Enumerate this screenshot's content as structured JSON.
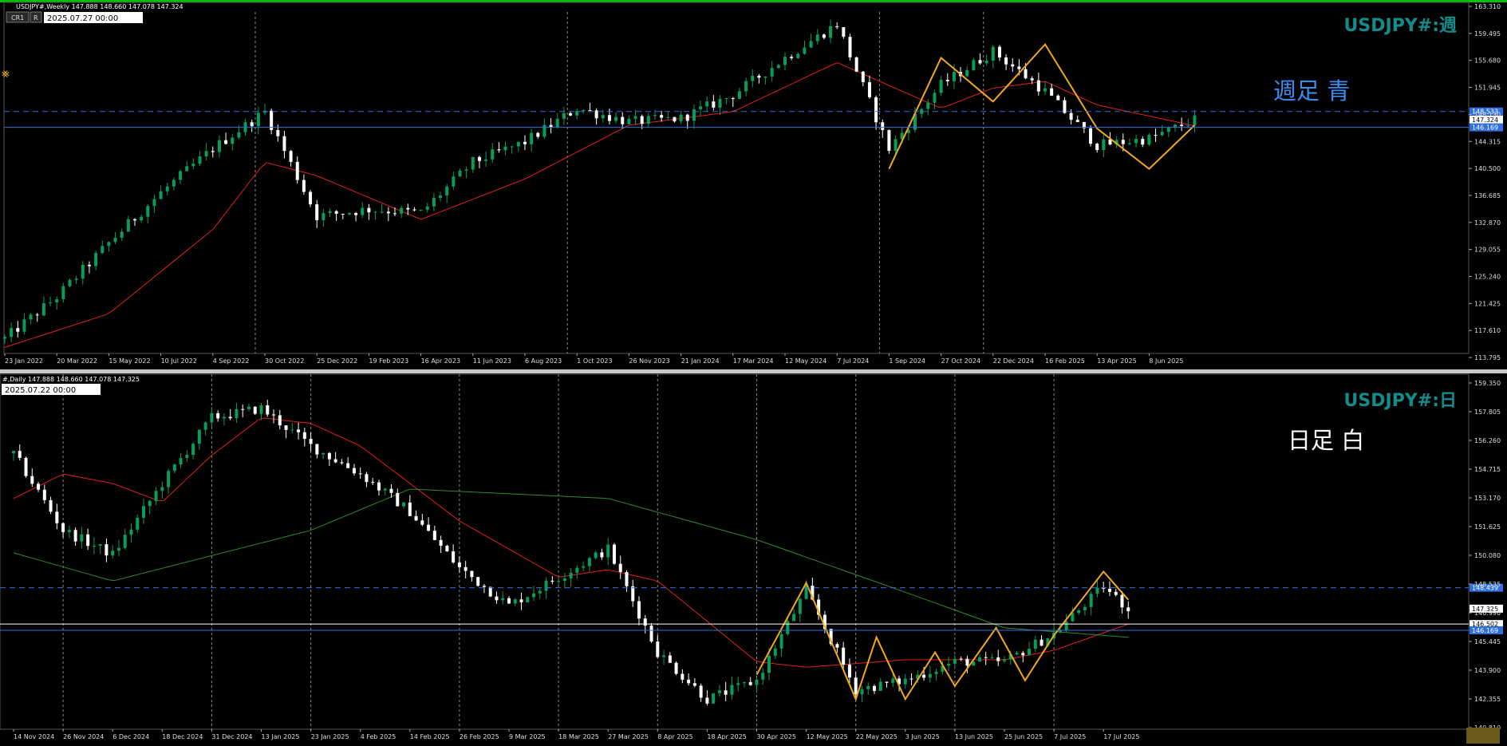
{
  "colors": {
    "background": "#000000",
    "bull": "#0A9D58",
    "bear": "#FFFFFF",
    "ma_fast": "#E0201E",
    "ma_slow": "#2E8B2E",
    "zigzag": "#F2A81D",
    "hline_blue": "#2F6FE0",
    "hline_white": "#FFFFFF",
    "grid": "#8A8A8A",
    "symbol": "#138C8C",
    "active_border": "#00C000"
  },
  "weekly": {
    "info_text": "USDJPY#,Weekly  147.888 148.660 147.078 147.324",
    "buttons": [
      "CR1",
      "R"
    ],
    "cursor_time": "2025.07.27 00:00",
    "symbol_label": "USDJPY#:週",
    "note_label": "週足 青",
    "y_ticks": [
      "163.310",
      "159.495",
      "155.680",
      "151.945",
      "148.130",
      "144.315",
      "140.500",
      "136.685",
      "132.870",
      "129.055",
      "125.240",
      "121.425",
      "117.610",
      "113.795"
    ],
    "x_labels": [
      "23 Jan 2022",
      "20 Mar 2022",
      "15 May 2022",
      "10 Jul 2022",
      "4 Sep 2022",
      "30 Oct 2022",
      "25 Dec 2022",
      "19 Feb 2023",
      "16 Apr 2023",
      "11 Jun 2023",
      "6 Aug 2023",
      "1 Oct 2023",
      "26 Nov 2023",
      "21 Jan 2024",
      "17 Mar 2024",
      "12 May 2024",
      "7 Jul 2024",
      "1 Sep 2024",
      "27 Oct 2024",
      "22 Dec 2024",
      "16 Feb 2025",
      "13 Apr 2025",
      "8 Jun 2025"
    ],
    "price_tags": [
      {
        "text": "148.533",
        "value": 148.533,
        "style": "blue"
      },
      {
        "text": "147.324",
        "value": 147.324,
        "style": "white"
      },
      {
        "text": "146.169",
        "value": 146.169,
        "style": "blue"
      }
    ]
  },
  "daily": {
    "info_text": "#,Daily  147.888 148.660 147.078 147.325",
    "cursor_time": "2025.07.22 00:00",
    "symbol_label": "USDJPY#:日",
    "note_label": "日足 白",
    "y_ticks": [
      "159.350",
      "157.805",
      "156.260",
      "154.715",
      "153.170",
      "151.625",
      "150.080",
      "148.535",
      "146.990",
      "145.445",
      "143.900",
      "142.355",
      "140.810"
    ],
    "x_labels": [
      "14 Nov 2024",
      "26 Nov 2024",
      "6 Dec 2024",
      "18 Dec 2024",
      "31 Dec 2024",
      "13 Jan 2025",
      "23 Jan 2025",
      "4 Feb 2025",
      "14 Feb 2025",
      "26 Feb 2025",
      "9 Mar 2025",
      "18 Mar 2025",
      "27 Mar 2025",
      "8 Apr 2025",
      "18 Apr 2025",
      "30 Apr 2025",
      "12 May 2025",
      "22 May 2025",
      "3 Jun 2025",
      "13 Jun 2025",
      "25 Jun 2025",
      "7 Jul 2025",
      "17 Jul 2025"
    ],
    "price_tags": [
      {
        "text": "148.439",
        "value": 148.439,
        "style": "blue"
      },
      {
        "text": "147.325",
        "value": 147.325,
        "style": "white"
      },
      {
        "text": "146.502",
        "value": 146.502,
        "style": "white"
      },
      {
        "text": "146.169",
        "value": 146.169,
        "style": "blue"
      }
    ]
  },
  "chart_data": [
    {
      "type": "candlestick",
      "symbol": "USDJPY#",
      "timeframe": "Weekly",
      "title": "USDJPY#:週",
      "ylim": [
        112.595,
        163.31
      ],
      "last_ohlc": {
        "open": 147.888,
        "high": 148.66,
        "low": 147.078,
        "close": 147.324
      },
      "horizontal_lines": [
        148.533,
        146.169
      ],
      "price_path": [
        [
          "23 Jan 2022",
          114.8
        ],
        [
          "20 Mar 2022",
          121.0
        ],
        [
          "15 May 2022",
          129.0
        ],
        [
          "10 Jul 2022",
          136.5
        ],
        [
          "4 Sep 2022",
          143.0
        ],
        [
          "30 Oct 2022",
          148.5
        ],
        [
          "25 Dec 2022",
          133.0
        ],
        [
          "19 Feb 2023",
          134.0
        ],
        [
          "16 Apr 2023",
          133.5
        ],
        [
          "11 Jun 2023",
          141.0
        ],
        [
          "6 Aug 2023",
          144.0
        ],
        [
          "1 Oct 2023",
          149.0
        ],
        [
          "26 Nov 2023",
          147.0
        ],
        [
          "21 Jan 2024",
          147.5
        ],
        [
          "17 Mar 2024",
          151.0
        ],
        [
          "12 May 2024",
          156.5
        ],
        [
          "7 Jul 2024",
          161.5
        ],
        [
          "1 Sep 2024",
          143.0
        ],
        [
          "27 Oct 2024",
          152.5
        ],
        [
          "22 Dec 2024",
          157.5
        ],
        [
          "16 Feb 2025",
          151.5
        ],
        [
          "13 Apr 2025",
          143.5
        ],
        [
          "8 Jun 2025",
          144.5
        ],
        [
          "27 Jul 2025",
          147.3
        ]
      ],
      "moving_averages": [
        {
          "path": [
            [
              "23 Jan 2022",
              113.5
            ],
            [
              "15 May 2022",
              118.5
            ],
            [
              "4 Sep 2022",
              131.0
            ],
            [
              "30 Oct 2022",
              141.0
            ],
            [
              "25 Dec 2022",
              139.0
            ],
            [
              "16 Apr 2023",
              132.5
            ],
            [
              "6 Aug 2023",
              138.5
            ],
            [
              "26 Nov 2023",
              146.5
            ],
            [
              "17 Mar 2024",
              148.5
            ],
            [
              "7 Jul 2024",
              155.8
            ],
            [
              "27 Oct 2024",
              149.0
            ],
            [
              "22 Dec 2024",
              152.0
            ],
            [
              "16 Feb 2025",
              153.0
            ],
            [
              "13 Apr 2025",
              149.5
            ],
            [
              "27 Jul 2025",
              146.4
            ]
          ]
        }
      ],
      "zigzag": [
        [
          "1 Sep 2024",
          140.0
        ],
        [
          "27 Oct 2024",
          156.5
        ],
        [
          "22 Dec 2024",
          150.0
        ],
        [
          "16 Feb 2025",
          158.5
        ],
        [
          "13 Apr 2025",
          146.0
        ],
        [
          "8 Jun 2025",
          140.0
        ],
        [
          "27 Jul 2025",
          146.5
        ]
      ]
    },
    {
      "type": "candlestick",
      "symbol": "USDJPY#",
      "timeframe": "Daily",
      "title": "USDJPY#:日",
      "ylim": [
        140.0,
        160.0
      ],
      "last_ohlc": {
        "open": 147.888,
        "high": 148.66,
        "low": 147.078,
        "close": 147.325
      },
      "horizontal_lines": [
        148.439,
        146.502,
        146.169
      ],
      "price_path": [
        [
          "14 Nov 2024",
          155.6
        ],
        [
          "26 Nov 2024",
          151.5
        ],
        [
          "6 Dec 2024",
          150.2
        ],
        [
          "18 Dec 2024",
          154.0
        ],
        [
          "31 Dec 2024",
          157.5
        ],
        [
          "13 Jan 2025",
          158.0
        ],
        [
          "23 Jan 2025",
          156.0
        ],
        [
          "4 Feb 2025",
          154.5
        ],
        [
          "14 Feb 2025",
          152.5
        ],
        [
          "26 Feb 2025",
          149.5
        ],
        [
          "9 Mar 2025",
          147.5
        ],
        [
          "18 Mar 2025",
          149.0
        ],
        [
          "27 Mar 2025",
          150.5
        ],
        [
          "8 Apr 2025",
          145.0
        ],
        [
          "18 Apr 2025",
          142.5
        ],
        [
          "30 Apr 2025",
          143.5
        ],
        [
          "12 May 2025",
          148.3
        ],
        [
          "22 May 2025",
          143.0
        ],
        [
          "3 Jun 2025",
          143.5
        ],
        [
          "13 Jun 2025",
          144.5
        ],
        [
          "25 Jun 2025",
          144.5
        ],
        [
          "7 Jul 2025",
          146.0
        ],
        [
          "17 Jul 2025",
          148.5
        ],
        [
          "22 Jul 2025",
          147.3
        ]
      ],
      "moving_averages": [
        {
          "color": "red",
          "path": [
            [
              "14 Nov 2024",
              153.2
            ],
            [
              "26 Nov 2024",
              154.5
            ],
            [
              "6 Dec 2024",
              154.0
            ],
            [
              "18 Dec 2024",
              153.0
            ],
            [
              "31 Dec 2024",
              155.5
            ],
            [
              "13 Jan 2025",
              157.5
            ],
            [
              "23 Jan 2025",
              157.2
            ],
            [
              "4 Feb 2025",
              156.0
            ],
            [
              "26 Feb 2025",
              152.0
            ],
            [
              "18 Mar 2025",
              149.0
            ],
            [
              "27 Mar 2025",
              149.4
            ],
            [
              "8 Apr 2025",
              148.8
            ],
            [
              "30 Apr 2025",
              144.5
            ],
            [
              "12 May 2025",
              144.2
            ],
            [
              "3 Jun 2025",
              144.6
            ],
            [
              "25 Jun 2025",
              144.6
            ],
            [
              "7 Jul 2025",
              145.1
            ],
            [
              "22 Jul 2025",
              146.5
            ]
          ]
        },
        {
          "color": "green",
          "path": [
            [
              "14 Nov 2024",
              150.3
            ],
            [
              "6 Dec 2024",
              148.8
            ],
            [
              "23 Jan 2025",
              151.5
            ],
            [
              "14 Feb 2025",
              153.7
            ],
            [
              "27 Mar 2025",
              153.2
            ],
            [
              "30 Apr 2025",
              151.0
            ],
            [
              "3 Jun 2025",
              148.2
            ],
            [
              "25 Jun 2025",
              146.3
            ],
            [
              "22 Jul 2025",
              145.8
            ]
          ]
        }
      ],
      "zigzag": [
        [
          "30 Apr 2025",
          143.8
        ],
        [
          "12 May 2025",
          148.7
        ],
        [
          "22 May 2025",
          142.5
        ],
        [
          "27 May 2025",
          145.8
        ],
        [
          "3 Jun 2025",
          142.5
        ],
        [
          "9 Jun 2025",
          145.0
        ],
        [
          "13 Jun 2025",
          143.2
        ],
        [
          "23 Jun 2025",
          146.3
        ],
        [
          "30 Jun 2025",
          143.5
        ],
        [
          "7 Jul 2025",
          145.9
        ],
        [
          "17 Jul 2025",
          149.3
        ],
        [
          "22 Jul 2025",
          147.8
        ]
      ]
    }
  ]
}
